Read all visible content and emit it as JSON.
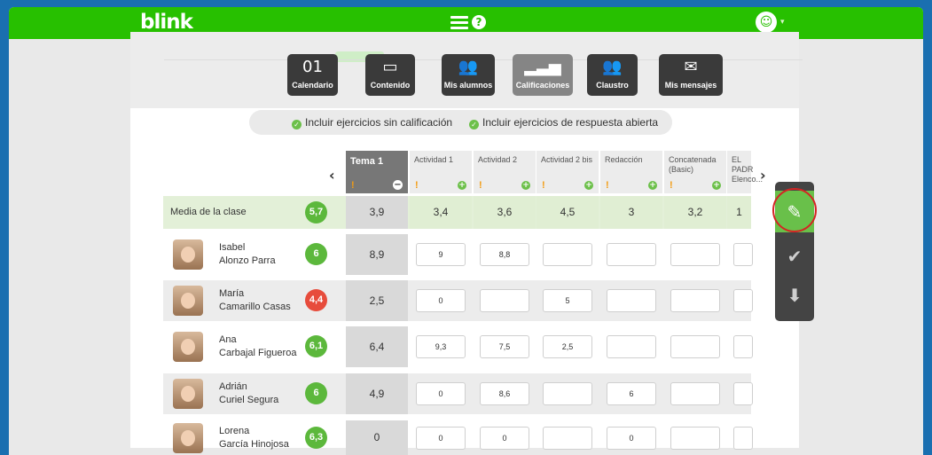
{
  "app": {
    "logo": "blink",
    "help_glyph": "?",
    "avatar_glyph": "☺",
    "caret": "▾"
  },
  "nav": [
    {
      "label": "Calendario",
      "icon": "calendar-icon",
      "glyph": "01"
    },
    {
      "label": "Contenido",
      "icon": "content-icon",
      "glyph": "▭"
    },
    {
      "label": "Mis alumnos",
      "icon": "students-icon",
      "glyph": "👥"
    },
    {
      "label": "Calificaciones",
      "icon": "chart-icon",
      "glyph": "▂▃▅"
    },
    {
      "label": "Claustro",
      "icon": "staff-icon",
      "glyph": "👥"
    },
    {
      "label": "Mis mensajes",
      "icon": "mail-icon",
      "glyph": "✉"
    }
  ],
  "filters": {
    "f1": "Incluir ejercicios sin calificación",
    "f2": "Incluir ejercicios de respuesta abierta"
  },
  "columns": [
    {
      "title": "Tema 1",
      "kind": "tema"
    },
    {
      "title": "Actividad 1"
    },
    {
      "title": "Actividad 2"
    },
    {
      "title": "Actividad 2 bis"
    },
    {
      "title": "Redacción"
    },
    {
      "title": "Concatenada (Basic)"
    },
    {
      "title": "EL PADR Elenco..."
    }
  ],
  "average": {
    "label": "Media de la clase",
    "badge": "5,7",
    "values": [
      "3,9",
      "3,4",
      "3,6",
      "4,5",
      "3",
      "3,2",
      "1"
    ]
  },
  "students": [
    {
      "first": "Isabel",
      "last": "Alonzo Parra",
      "badge": "6",
      "badge_color": "green",
      "tema": "8,9",
      "grades": [
        "9",
        "8,8",
        "",
        "",
        "",
        ""
      ]
    },
    {
      "first": "María",
      "last": "Camarillo Casas",
      "badge": "4,4",
      "badge_color": "red",
      "tema": "2,5",
      "grades": [
        "0",
        "",
        "5",
        "",
        "",
        ""
      ]
    },
    {
      "first": "Ana",
      "last": "Carbajal Figueroa",
      "badge": "6,1",
      "badge_color": "green",
      "tema": "6,4",
      "grades": [
        "9,3",
        "7,5",
        "2,5",
        "",
        "",
        ""
      ]
    },
    {
      "first": "Adrián",
      "last": "Curiel Segura",
      "badge": "6",
      "badge_color": "green",
      "tema": "4,9",
      "grades": [
        "0",
        "8,6",
        "",
        "6",
        "",
        ""
      ]
    },
    {
      "first": "Lorena",
      "last": "García Hinojosa",
      "badge": "6,3",
      "badge_color": "green",
      "tema": "0",
      "grades": [
        "0",
        "0",
        "",
        "0",
        "",
        ""
      ]
    }
  ],
  "header_marks": {
    "warn": "!",
    "plus": "+",
    "minus": "−",
    "prev": "‹",
    "next": "›"
  },
  "tools": {
    "edit": "✎",
    "check": "✔",
    "download": "⬇"
  }
}
